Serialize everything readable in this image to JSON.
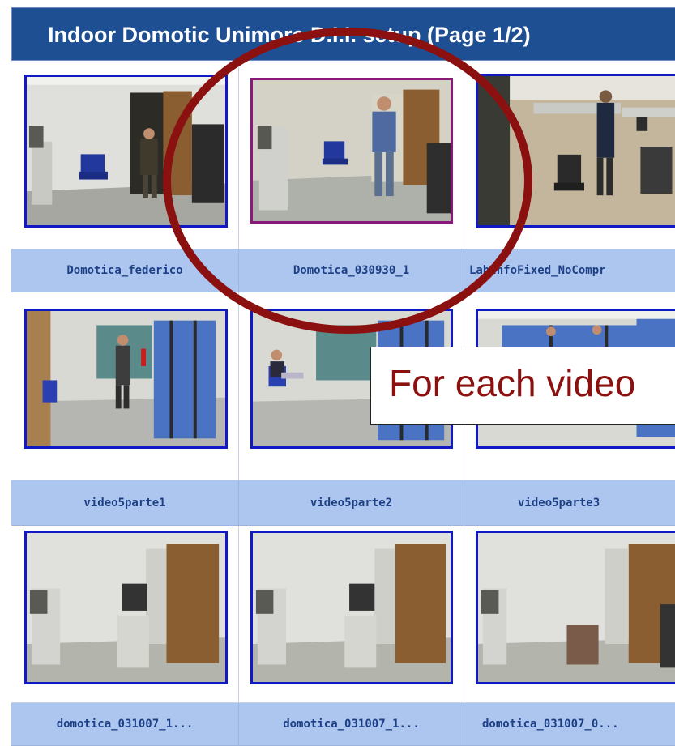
{
  "header": {
    "title": "Indoor Domotic Unimore D.I.I. setup (Page 1/2)"
  },
  "callout": {
    "text": "For each video"
  },
  "grid": {
    "rows": [
      {
        "labels": [
          "Domotica_federico",
          "Domotica_030930_1",
          "LabInfoFixed_NoCompr"
        ]
      },
      {
        "labels": [
          "video5parte1",
          "video5parte2",
          "video5parte3"
        ]
      },
      {
        "labels": [
          "domotica_031007_1...",
          "domotica_031007_1...",
          "domotica_031007_0..."
        ]
      }
    ]
  },
  "colors": {
    "header_bg": "#1f4f93",
    "label_bg": "#adc6ef",
    "label_text": "#1d3f86",
    "thumb_border": "#1019c4",
    "annotation": "#8b1010"
  }
}
